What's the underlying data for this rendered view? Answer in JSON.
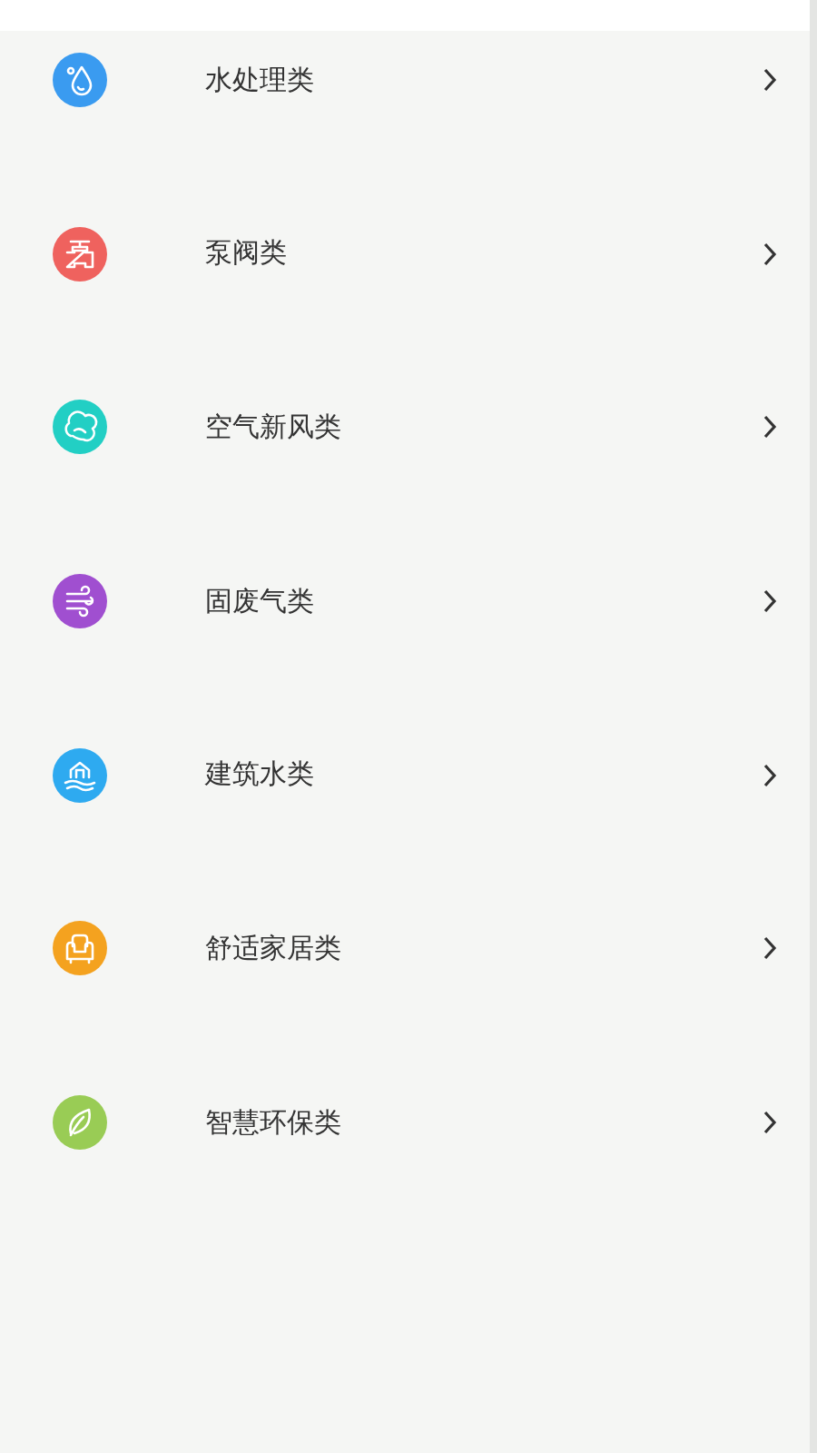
{
  "categories": [
    {
      "label": "水处理类",
      "kind": "droplet",
      "color": "#3a9bf0"
    },
    {
      "label": "泵阀类",
      "kind": "valve",
      "color": "#ef625e"
    },
    {
      "label": "空气新风类",
      "kind": "cloud",
      "color": "#22cfc4"
    },
    {
      "label": "固废气类",
      "kind": "wind",
      "color": "#a04fd0"
    },
    {
      "label": "建筑水类",
      "kind": "house",
      "color": "#2eaaf0"
    },
    {
      "label": "舒适家居类",
      "kind": "armchair",
      "color": "#f4a21f"
    },
    {
      "label": "智慧环保类",
      "kind": "leaf",
      "color": "#99cc55"
    }
  ]
}
